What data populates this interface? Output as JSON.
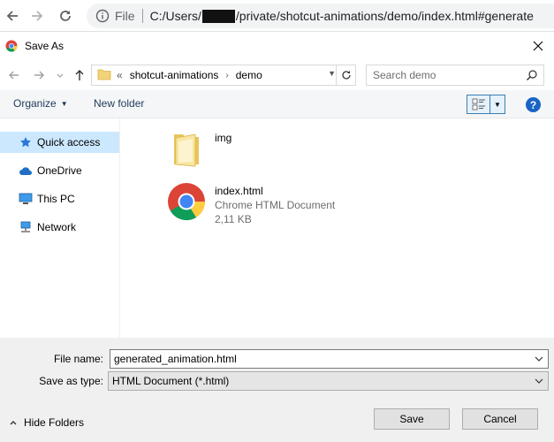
{
  "browser": {
    "scheme": "File",
    "url_prefix": "C:/Users/",
    "url_suffix": "/private/shotcut-animations/demo/index.html#generate"
  },
  "dialog": {
    "title": "Save As"
  },
  "address": {
    "overflow": "«",
    "crumbs": [
      "shotcut-animations",
      "demo"
    ],
    "search_placeholder": "Search demo"
  },
  "commands": {
    "organize": "Organize",
    "new_folder": "New folder",
    "help": "?"
  },
  "nav": {
    "items": [
      {
        "label": "Quick access",
        "icon": "star-icon",
        "selected": true
      },
      {
        "label": "OneDrive",
        "icon": "cloud-icon"
      },
      {
        "label": "This PC",
        "icon": "monitor-icon"
      },
      {
        "label": "Network",
        "icon": "network-icon"
      }
    ]
  },
  "files": [
    {
      "name": "img",
      "icon": "folder-icon"
    },
    {
      "name": "index.html",
      "type": "Chrome HTML Document",
      "size": "2,11 KB",
      "icon": "chrome-icon"
    }
  ],
  "form": {
    "file_name_label": "File name:",
    "file_name_value": "generated_animation.html",
    "save_type_label": "Save as type:",
    "save_type_value": "HTML Document (*.html)"
  },
  "footer": {
    "hide_folders": "Hide Folders",
    "save": "Save",
    "cancel": "Cancel"
  },
  "colors": {
    "selection": "#cce8ff",
    "accent": "#1a63c6",
    "panel": "#f0f0f0"
  }
}
